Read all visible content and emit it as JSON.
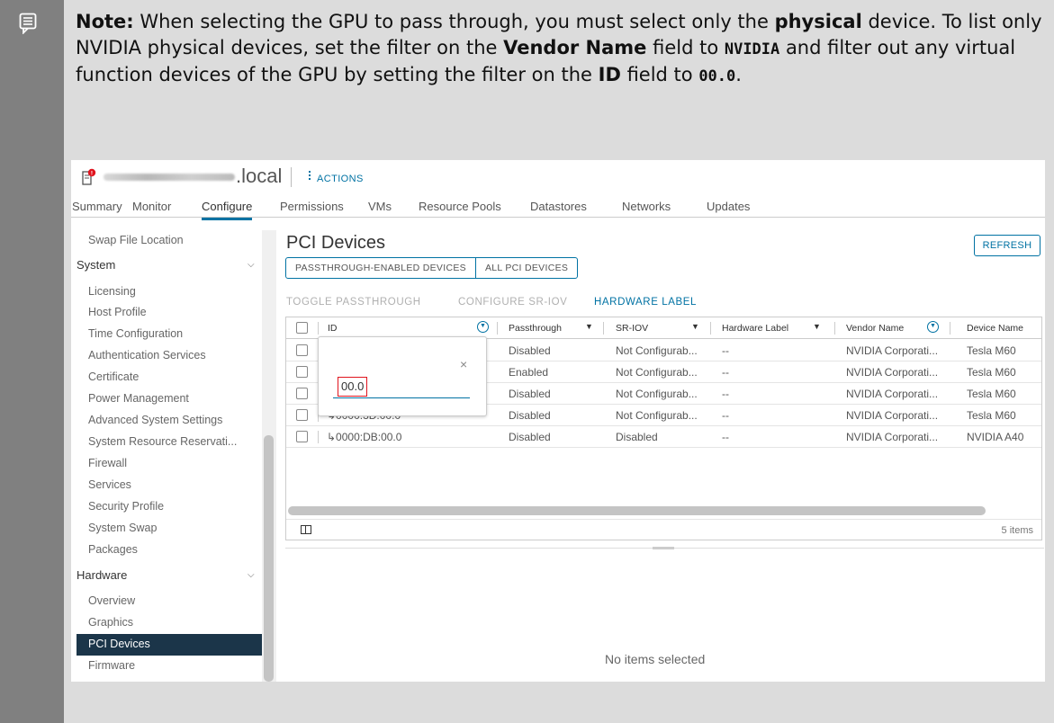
{
  "note": {
    "label": "Note:",
    "t1": " When selecting the GPU to pass through, you must select only the ",
    "physical": "physical",
    "t2": " device. To list only NVIDIA physical devices, set the filter on the ",
    "vendor_name": "Vendor Name",
    "t3": " field to ",
    "nvidia": "NVIDIA",
    "t4": " and filter out any virtual function devices of the GPU by setting the filter on the ",
    "id": "ID",
    "t5": " field to ",
    "value": "00.0",
    "t6": "."
  },
  "host": {
    "suffix": ".local",
    "actions": "ACTIONS"
  },
  "tabs": [
    "Summary",
    "Monitor",
    "Configure",
    "Permissions",
    "VMs",
    "Resource Pools",
    "Datastores",
    "Networks",
    "Updates"
  ],
  "nav": {
    "swap_file": "Swap File Location",
    "system": "System",
    "system_items": [
      "Licensing",
      "Host Profile",
      "Time Configuration",
      "Authentication Services",
      "Certificate",
      "Power Management",
      "Advanced System Settings",
      "System Resource Reservati...",
      "Firewall",
      "Services",
      "Security Profile",
      "System Swap",
      "Packages"
    ],
    "hardware": "Hardware",
    "hardware_items": [
      "Overview",
      "Graphics",
      "PCI Devices",
      "Firmware"
    ]
  },
  "main": {
    "title": "PCI Devices",
    "refresh": "REFRESH",
    "seg": [
      "PASSTHROUGH-ENABLED DEVICES",
      "ALL PCI DEVICES"
    ],
    "actions": [
      "TOGGLE PASSTHROUGH",
      "CONFIGURE SR-IOV",
      "HARDWARE LABEL"
    ],
    "columns": [
      "ID",
      "Passthrough",
      "SR-IOV",
      "Hardware Label",
      "Vendor Name",
      "Device Name"
    ],
    "rows": [
      {
        "id": "",
        "passthrough": "Disabled",
        "sriov": "Not Configurab...",
        "label": "--",
        "vendor": "NVIDIA Corporati...",
        "device": "Tesla M60"
      },
      {
        "id": "",
        "passthrough": "Enabled",
        "sriov": "Not Configurab...",
        "label": "--",
        "vendor": "NVIDIA Corporati...",
        "device": "Tesla M60"
      },
      {
        "id": "",
        "passthrough": "Disabled",
        "sriov": "Not Configurab...",
        "label": "--",
        "vendor": "NVIDIA Corporati...",
        "device": "Tesla M60"
      },
      {
        "id": "↳0000:3D:00.0",
        "passthrough": "Disabled",
        "sriov": "Not Configurab...",
        "label": "--",
        "vendor": "NVIDIA Corporati...",
        "device": "Tesla M60"
      },
      {
        "id": "↳0000:DB:00.0",
        "passthrough": "Disabled",
        "sriov": "Disabled",
        "label": "--",
        "vendor": "NVIDIA Corporati...",
        "device": "NVIDIA A40"
      }
    ],
    "count": "5 items",
    "no_items": "No items selected"
  },
  "filter": {
    "value": "00.0",
    "close": "×"
  }
}
